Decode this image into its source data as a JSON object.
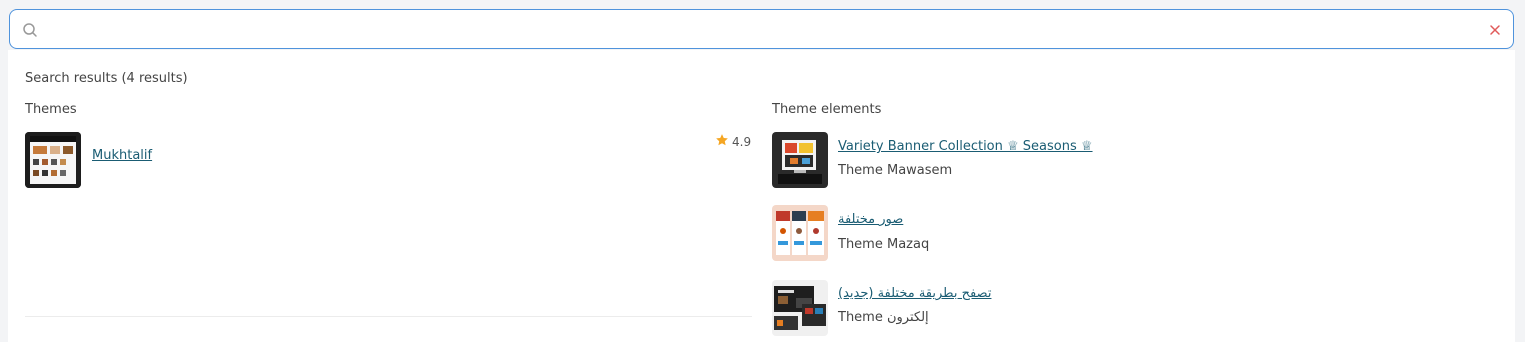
{
  "search": {
    "placeholder": "",
    "value": ""
  },
  "results": {
    "summary": "Search results (4 results)"
  },
  "themes": {
    "heading": "Themes",
    "items": [
      {
        "name": "Mukhtalif",
        "rating": "4.9"
      }
    ]
  },
  "theme_elements": {
    "heading": "Theme elements",
    "items": [
      {
        "title": "Variety Banner Collection ♕ Seasons ♕",
        "subtitle": "Theme Mawasem"
      },
      {
        "title": "صور مختلفة",
        "subtitle": "Theme Mazaq"
      },
      {
        "title": "تصفح بطريقة مختلفة (جديد)",
        "subtitle": "Theme إلكترون"
      }
    ]
  },
  "colors": {
    "accent_border": "#4f93dc",
    "link": "#1a5c73",
    "star": "#f5a623",
    "clear_icon": "#e05a5a"
  }
}
